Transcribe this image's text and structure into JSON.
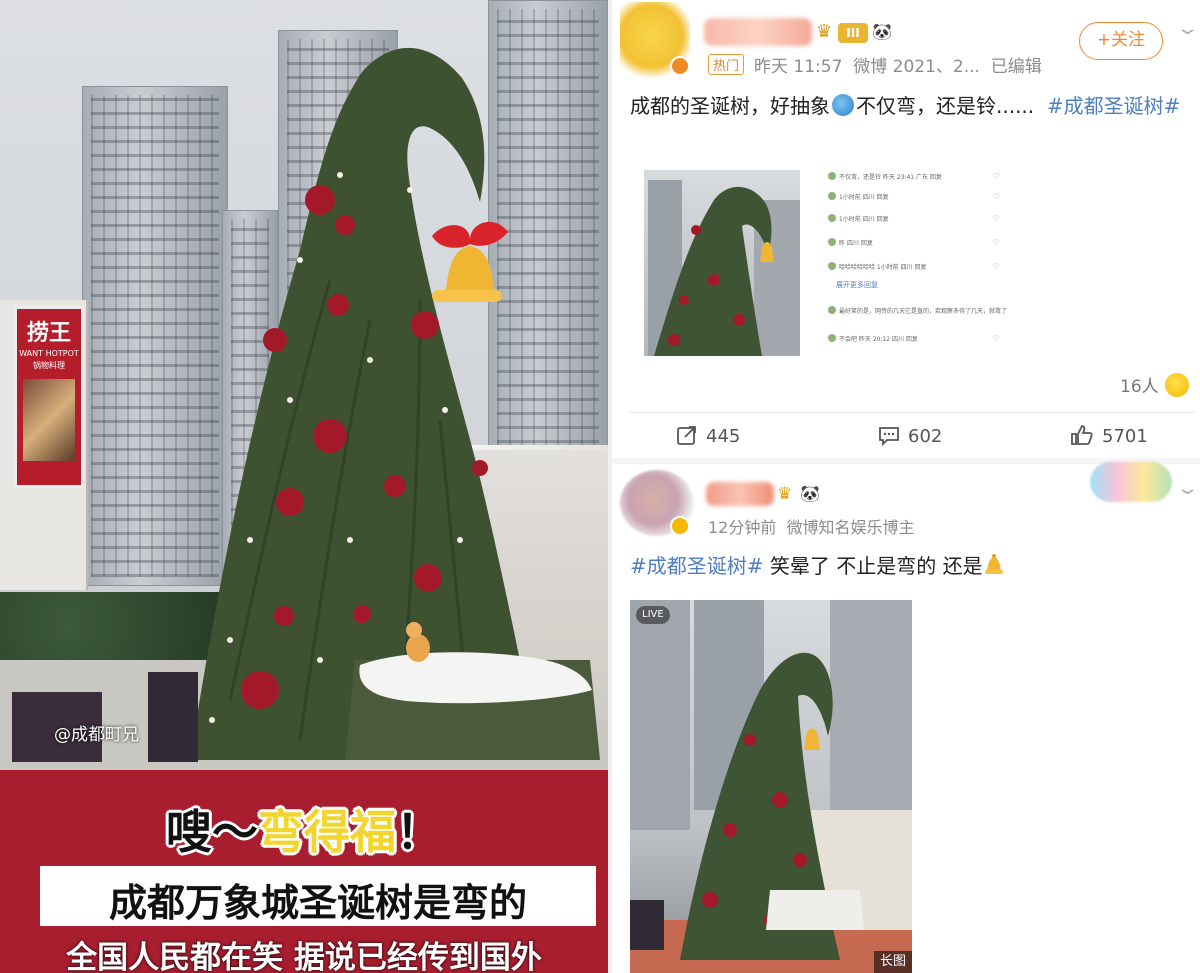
{
  "left_photo": {
    "mall_sign_main": "捞王",
    "mall_sign_sub": "WANT HOTPOT",
    "mall_sign_sub2": "锅物料理",
    "watermark": "@成都町兄",
    "caption_line1_part1": "嗖～",
    "caption_line1_part2": "弯得福",
    "caption_line1_part3": "！",
    "caption_line2": "成都万象城圣诞树是弯的",
    "caption_line3": "全国人民都在笑 据说已经传到国外"
  },
  "post1": {
    "level_badge": "III",
    "hot_tag": "热门",
    "time": "昨天 11:57",
    "source": "微博 2021、2...",
    "edited": "已编辑",
    "follow_label": "+关注",
    "text_before": "成都的圣诞树，好抽象",
    "text_after": "不仅弯，还是铃......",
    "hashtag": "#成都圣诞树#",
    "reaction_count": "16人",
    "reposts": "445",
    "comments": "602",
    "likes": "5701"
  },
  "post1_comments_shot": {
    "rows": [
      "不仅弯，还是铃 昨天 23:41 广东 回复",
      "1小时前 四川 回复",
      "1小时前 四川 回复",
      "昨 四川 回复",
      "哈哈哈哈哈哈 1小时前 四川 回复",
      "展开更多回复",
      "最好笑的是，网传的几天它是直的，若观察多待了几天，就弯了",
      "不会吧 昨天 20:12 四川 回复"
    ]
  },
  "post2": {
    "time": "12分钟前",
    "source": "微博知名娱乐博主",
    "hashtag": "#成都圣诞树#",
    "text": "笑晕了 不止是弯的 还是",
    "live_label": "LIVE",
    "long_label": "长图"
  },
  "colors": {
    "hashtag": "#4f7fc0",
    "follow": "#f08a34",
    "caption_bg": "#a81e2e",
    "caption_highlight": "#f2d52e"
  }
}
